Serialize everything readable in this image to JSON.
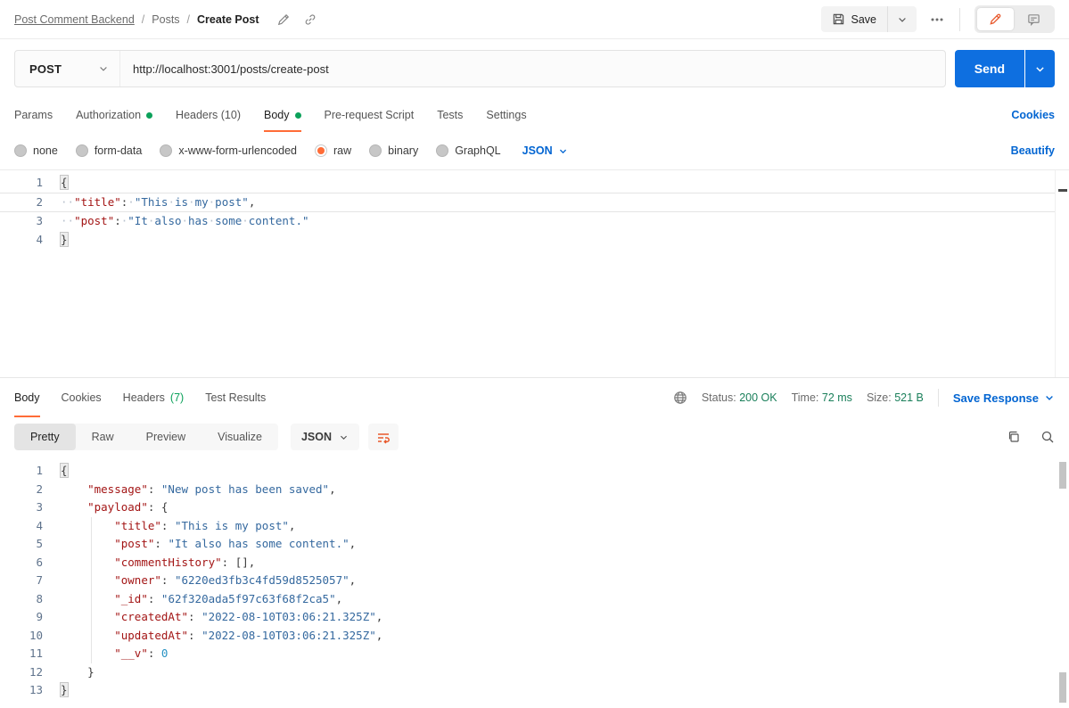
{
  "header": {
    "breadcrumb": {
      "collection": "Post Comment Backend",
      "separator": "/",
      "folder": "Posts",
      "request": "Create Post"
    },
    "save_label": "Save"
  },
  "request": {
    "method": "POST",
    "url": "http://localhost:3001/posts/create-post",
    "send_label": "Send",
    "cookies_label": "Cookies",
    "tabs": [
      {
        "label": "Params",
        "dot": false,
        "active": false
      },
      {
        "label": "Authorization",
        "dot": true,
        "active": false
      },
      {
        "label": "Headers (10)",
        "dot": false,
        "active": false
      },
      {
        "label": "Body",
        "dot": true,
        "active": true
      },
      {
        "label": "Pre-request Script",
        "dot": false,
        "active": false
      },
      {
        "label": "Tests",
        "dot": false,
        "active": false
      },
      {
        "label": "Settings",
        "dot": false,
        "active": false
      }
    ],
    "body_modes": [
      {
        "label": "none",
        "selected": false
      },
      {
        "label": "form-data",
        "selected": false
      },
      {
        "label": "x-www-form-urlencoded",
        "selected": false
      },
      {
        "label": "raw",
        "selected": true
      },
      {
        "label": "binary",
        "selected": false
      },
      {
        "label": "GraphQL",
        "selected": false
      }
    ],
    "language": "JSON",
    "beautify_label": "Beautify",
    "editor": {
      "show_whitespace": true,
      "lines": [
        {
          "n": 1,
          "tokens": [
            {
              "t": "punc",
              "v": "{",
              "hl": true
            }
          ]
        },
        {
          "n": 2,
          "active": true,
          "tokens": [
            {
              "t": "ws",
              "v": "  "
            },
            {
              "t": "key",
              "v": "\"title\""
            },
            {
              "t": "punc",
              "v": ":"
            },
            {
              "t": "ws",
              "v": " "
            },
            {
              "t": "str",
              "v": "\"This is my post\""
            },
            {
              "t": "punc",
              "v": ","
            }
          ]
        },
        {
          "n": 3,
          "tokens": [
            {
              "t": "ws",
              "v": "  "
            },
            {
              "t": "key",
              "v": "\"post\""
            },
            {
              "t": "punc",
              "v": ":"
            },
            {
              "t": "ws",
              "v": " "
            },
            {
              "t": "str",
              "v": "\"It also has some content.\""
            }
          ]
        },
        {
          "n": 4,
          "tokens": [
            {
              "t": "punc",
              "v": "}",
              "hl": true
            }
          ]
        }
      ]
    }
  },
  "response": {
    "tabs": [
      {
        "label": "Body",
        "count": "",
        "active": true
      },
      {
        "label": "Cookies",
        "count": "",
        "active": false
      },
      {
        "label": "Headers",
        "count": "(7)",
        "active": false
      },
      {
        "label": "Test Results",
        "count": "",
        "active": false
      }
    ],
    "meta": {
      "status_label": "Status:",
      "status_value": "200 OK",
      "time_label": "Time:",
      "time_value": "72 ms",
      "size_label": "Size:",
      "size_value": "521 B"
    },
    "save_response_label": "Save Response",
    "view_tabs": [
      {
        "label": "Pretty",
        "active": true
      },
      {
        "label": "Raw",
        "active": false
      },
      {
        "label": "Preview",
        "active": false
      },
      {
        "label": "Visualize",
        "active": false
      }
    ],
    "language": "JSON",
    "editor": {
      "show_whitespace": false,
      "lines": [
        {
          "n": 1,
          "tokens": [
            {
              "t": "punc",
              "v": "{",
              "hl": true
            }
          ]
        },
        {
          "n": 2,
          "tokens": [
            {
              "t": "ws",
              "v": "    "
            },
            {
              "t": "key",
              "v": "\"message\""
            },
            {
              "t": "punc",
              "v": ":"
            },
            {
              "t": "ws",
              "v": " "
            },
            {
              "t": "str",
              "v": "\"New post has been saved\""
            },
            {
              "t": "punc",
              "v": ","
            }
          ]
        },
        {
          "n": 3,
          "tokens": [
            {
              "t": "ws",
              "v": "    "
            },
            {
              "t": "key",
              "v": "\"payload\""
            },
            {
              "t": "punc",
              "v": ":"
            },
            {
              "t": "ws",
              "v": " "
            },
            {
              "t": "punc",
              "v": "{"
            }
          ]
        },
        {
          "n": 4,
          "guide": true,
          "tokens": [
            {
              "t": "ws",
              "v": "        "
            },
            {
              "t": "key",
              "v": "\"title\""
            },
            {
              "t": "punc",
              "v": ":"
            },
            {
              "t": "ws",
              "v": " "
            },
            {
              "t": "str",
              "v": "\"This is my post\""
            },
            {
              "t": "punc",
              "v": ","
            }
          ]
        },
        {
          "n": 5,
          "guide": true,
          "tokens": [
            {
              "t": "ws",
              "v": "        "
            },
            {
              "t": "key",
              "v": "\"post\""
            },
            {
              "t": "punc",
              "v": ":"
            },
            {
              "t": "ws",
              "v": " "
            },
            {
              "t": "str",
              "v": "\"It also has some content.\""
            },
            {
              "t": "punc",
              "v": ","
            }
          ]
        },
        {
          "n": 6,
          "guide": true,
          "tokens": [
            {
              "t": "ws",
              "v": "        "
            },
            {
              "t": "key",
              "v": "\"commentHistory\""
            },
            {
              "t": "punc",
              "v": ":"
            },
            {
              "t": "ws",
              "v": " "
            },
            {
              "t": "punc",
              "v": "[],"
            }
          ]
        },
        {
          "n": 7,
          "guide": true,
          "tokens": [
            {
              "t": "ws",
              "v": "        "
            },
            {
              "t": "key",
              "v": "\"owner\""
            },
            {
              "t": "punc",
              "v": ":"
            },
            {
              "t": "ws",
              "v": " "
            },
            {
              "t": "str",
              "v": "\"6220ed3fb3c4fd59d8525057\""
            },
            {
              "t": "punc",
              "v": ","
            }
          ]
        },
        {
          "n": 8,
          "guide": true,
          "tokens": [
            {
              "t": "ws",
              "v": "        "
            },
            {
              "t": "key",
              "v": "\"_id\""
            },
            {
              "t": "punc",
              "v": ":"
            },
            {
              "t": "ws",
              "v": " "
            },
            {
              "t": "str",
              "v": "\"62f320ada5f97c63f68f2ca5\""
            },
            {
              "t": "punc",
              "v": ","
            }
          ]
        },
        {
          "n": 9,
          "guide": true,
          "tokens": [
            {
              "t": "ws",
              "v": "        "
            },
            {
              "t": "key",
              "v": "\"createdAt\""
            },
            {
              "t": "punc",
              "v": ":"
            },
            {
              "t": "ws",
              "v": " "
            },
            {
              "t": "str",
              "v": "\"2022-08-10T03:06:21.325Z\""
            },
            {
              "t": "punc",
              "v": ","
            }
          ]
        },
        {
          "n": 10,
          "guide": true,
          "tokens": [
            {
              "t": "ws",
              "v": "        "
            },
            {
              "t": "key",
              "v": "\"updatedAt\""
            },
            {
              "t": "punc",
              "v": ":"
            },
            {
              "t": "ws",
              "v": " "
            },
            {
              "t": "str",
              "v": "\"2022-08-10T03:06:21.325Z\""
            },
            {
              "t": "punc",
              "v": ","
            }
          ]
        },
        {
          "n": 11,
          "guide": true,
          "tokens": [
            {
              "t": "ws",
              "v": "        "
            },
            {
              "t": "key",
              "v": "\"__v\""
            },
            {
              "t": "punc",
              "v": ":"
            },
            {
              "t": "ws",
              "v": " "
            },
            {
              "t": "num",
              "v": "0"
            }
          ]
        },
        {
          "n": 12,
          "tokens": [
            {
              "t": "ws",
              "v": "    "
            },
            {
              "t": "punc",
              "v": "}"
            }
          ]
        },
        {
          "n": 13,
          "tokens": [
            {
              "t": "punc",
              "v": "}",
              "hl": true
            }
          ]
        }
      ]
    }
  },
  "colors": {
    "accent_orange": "#FF6C37",
    "link_blue": "#0265D2",
    "success_green": "#0CA15A",
    "send_blue": "#0E6FE0"
  }
}
